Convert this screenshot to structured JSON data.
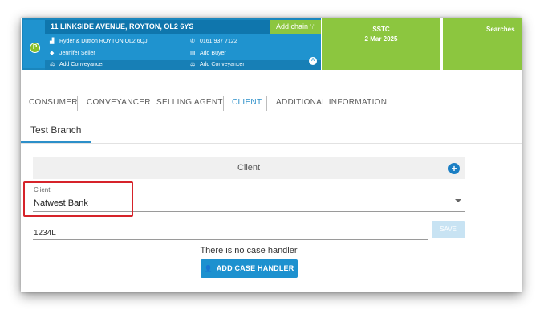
{
  "banner": {
    "badge": "P",
    "address": "11 LINKSIDE AVENUE, ROYTON, OL2 6YS",
    "add_chain": "Add chain",
    "add_chain_icon": "branch-icon",
    "agent": "Ryder & Dutton ROYTON OL2 6QJ",
    "phone": "0161 937 7122",
    "seller": "Jennifer Seller",
    "buyer": "Add Buyer",
    "conveyancer_left": "Add Conveyancer",
    "conveyancer_right": "Add Conveyancer",
    "status": {
      "label": "SSTC",
      "date": "2 Mar 2025"
    },
    "searches": "Searches",
    "colors": {
      "blue": "#1f93cf",
      "dark_blue": "#0f76ad",
      "green": "#8cc63f"
    }
  },
  "tabs": [
    {
      "label": "CONSUMER"
    },
    {
      "label": "CONVEYANCER"
    },
    {
      "label": "SELLING AGENT"
    },
    {
      "label": "CLIENT",
      "active": true
    },
    {
      "label": "ADDITIONAL INFORMATION"
    }
  ],
  "branch_tab": "Test Branch",
  "client_panel": {
    "title": "Client",
    "client_field": {
      "label": "Client",
      "value": "Natwest Bank"
    },
    "reference": {
      "value": "1234L"
    },
    "save_label": "SAVE",
    "no_handler_text": "There is no case handler",
    "add_handler_label": "ADD CASE HANDLER"
  },
  "highlight_color": "#d6232a"
}
